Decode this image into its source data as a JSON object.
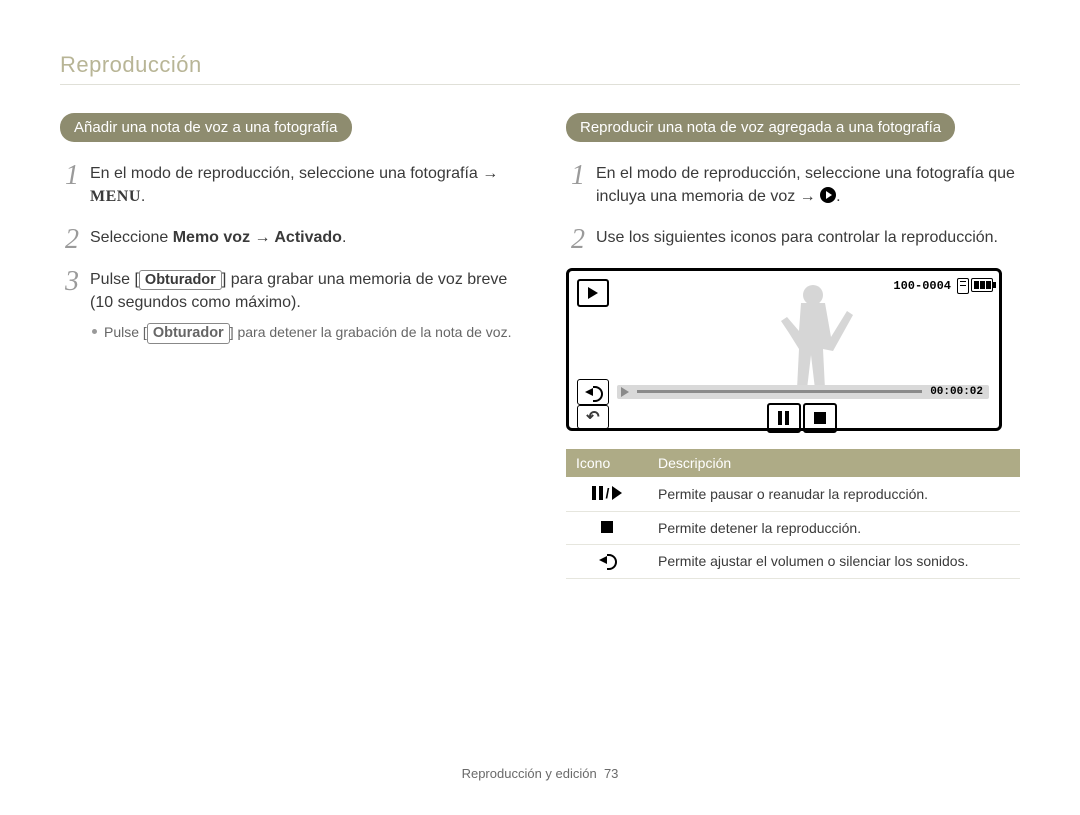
{
  "breadcrumb": "Reproducción",
  "left": {
    "heading": "Añadir una nota de voz a una fotografía",
    "step1_pre": "En el modo de reproducción, seleccione una fotografía → ",
    "step1_menu": "MENU",
    "step1_post": ".",
    "step2_pre": "Seleccione ",
    "step2_bold": "Memo voz → Activado",
    "step2_post": ".",
    "step3_pre": "Pulse [",
    "step3_btn": "Obturador",
    "step3_post": "] para grabar una memoria de voz breve (10 segundos como máximo).",
    "step3_sub_pre": "Pulse [",
    "step3_sub_btn": "Obturador",
    "step3_sub_post": "] para detener la grabación de la nota de voz."
  },
  "right": {
    "heading": "Reproducir una nota de voz agregada a una fotografía",
    "step1_pre": "En el modo de reproducción, seleccione una fotografía que incluya una memoria de voz → ",
    "step1_post": ".",
    "step2": "Use los siguientes iconos para controlar la reproducción.",
    "screen": {
      "file_number": "100-0004",
      "time": "00:00:02"
    },
    "table": {
      "col_icon": "Icono",
      "col_desc": "Descripción",
      "rows": [
        {
          "icon": "pause-play",
          "desc": "Permite pausar o reanudar la reproducción."
        },
        {
          "icon": "stop",
          "desc": "Permite detener la reproducción."
        },
        {
          "icon": "speaker",
          "desc": "Permite ajustar el volumen o silenciar los sonidos."
        }
      ]
    }
  },
  "footer_label": "Reproducción y edición",
  "footer_pagenum": "73"
}
